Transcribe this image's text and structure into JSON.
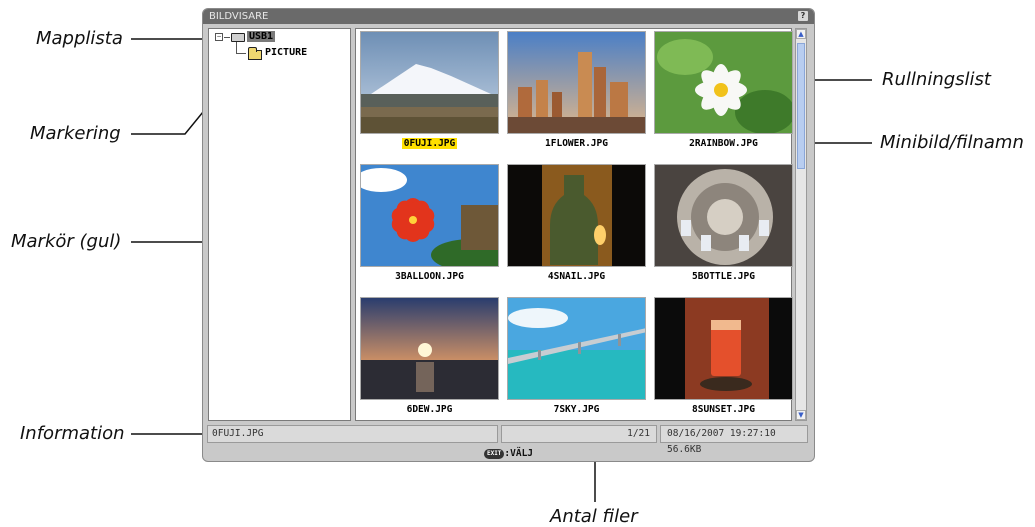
{
  "window": {
    "title": "BILDVISARE",
    "help_label": "?"
  },
  "tree": {
    "expander": "−",
    "drive_label": "USB1",
    "folder_label": "PICTURE"
  },
  "thumbnails": [
    {
      "filename": "0FUJI.JPG",
      "selected": true
    },
    {
      "filename": "1FLOWER.JPG",
      "selected": false
    },
    {
      "filename": "2RAINBOW.JPG",
      "selected": false
    },
    {
      "filename": "3BALLOON.JPG",
      "selected": false
    },
    {
      "filename": "4SNAIL.JPG",
      "selected": false
    },
    {
      "filename": "5BOTTLE.JPG",
      "selected": false
    },
    {
      "filename": "6DEW.JPG",
      "selected": false
    },
    {
      "filename": "7SKY.JPG",
      "selected": false
    },
    {
      "filename": "8SUNSET.JPG",
      "selected": false
    }
  ],
  "scrollbar": {
    "up": "▲",
    "down": "▼"
  },
  "status": {
    "filename": "0FUJI.JPG",
    "count": "1/21",
    "datetime_size": "08/16/2007 19:27:10  56.6KB"
  },
  "footer": {
    "exit_key": "EXIT",
    "label": ":VÄLJ"
  },
  "callouts": {
    "folder_list": "Mapplista",
    "selection": "Markering",
    "cursor": "Markör (gul)",
    "information": "Information",
    "scrollbar": "Rullningslist",
    "thumbnail": "Minibild/filnamn",
    "file_count": "Antal filer"
  }
}
